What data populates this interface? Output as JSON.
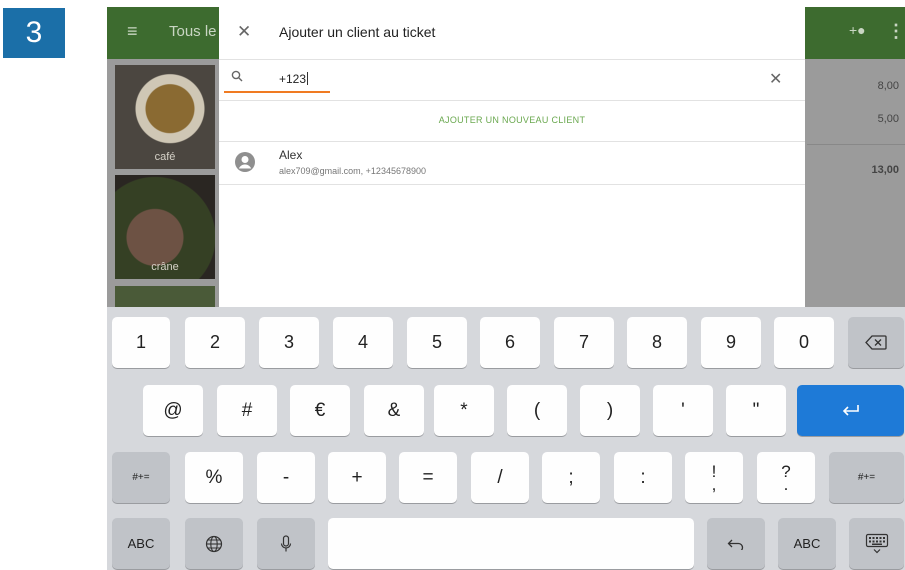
{
  "step_number": "3",
  "background_app": {
    "category_label": "Tous le",
    "tiles": [
      "café",
      "crâne"
    ],
    "ticket": {
      "prices": [
        "8,00",
        "5,00"
      ],
      "total": "13,00"
    }
  },
  "dialog": {
    "title": "Ajouter un client au ticket",
    "search": {
      "value": "+123"
    },
    "add_new_label": "AJOUTER UN NOUVEAU CLIENT",
    "clients": [
      {
        "name": "Alex",
        "detail": "alex709@gmail.com, +12345678900"
      }
    ]
  },
  "keyboard": {
    "row1": [
      "1",
      "2",
      "3",
      "4",
      "5",
      "6",
      "7",
      "8",
      "9",
      "0"
    ],
    "row2": [
      "@",
      "#",
      "€",
      "&",
      "*",
      "(",
      ")",
      "'",
      "\""
    ],
    "row3": [
      "%",
      "-",
      "+",
      "=",
      "/",
      ";",
      ":"
    ],
    "row3_stacked": [
      [
        "!",
        ","
      ],
      [
        "?",
        "."
      ]
    ],
    "shift_left": "#+=",
    "shift_right": "#+=",
    "abc_left": "ABC",
    "abc_right": "ABC",
    "icons": {
      "backspace": "backspace-icon",
      "return": "return-icon",
      "globe": "globe-icon",
      "mic": "microphone-icon",
      "undo": "undo-icon",
      "hide": "keyboard-hide-icon"
    }
  },
  "colors": {
    "accent_green": "#6aa84f",
    "search_underline": "#f07b22",
    "return_key": "#1e7ad7",
    "step_badge": "#1b6fa8",
    "topbar": "#3d6b2f"
  }
}
